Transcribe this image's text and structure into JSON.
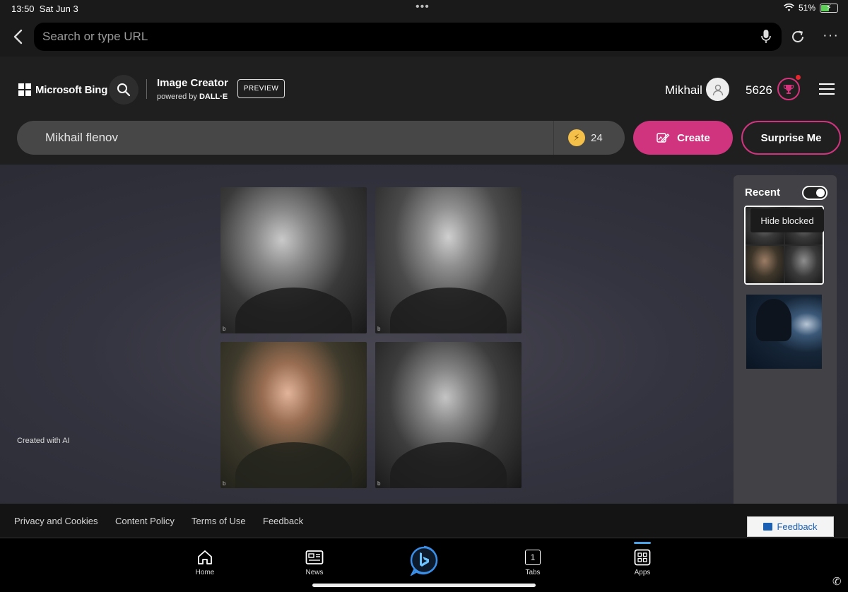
{
  "status_bar": {
    "time": "13:50",
    "date": "Sat Jun 3",
    "battery": "51%",
    "battery_level": 0.51
  },
  "browser": {
    "url_placeholder": "Search or type URL"
  },
  "header": {
    "brand": "Microsoft Bing",
    "product_title": "Image Creator",
    "powered_by": "powered by",
    "powered_by_brand": "DALL·E",
    "badge": "PREVIEW",
    "user_name": "Mikhail",
    "points": "5626"
  },
  "prompt": {
    "value": "Mikhail flenov",
    "boosts": "24"
  },
  "actions": {
    "create_label": "Create",
    "surprise_label": "Surprise Me"
  },
  "main": {
    "created_with_ai": "Created with AI"
  },
  "recent": {
    "title": "Recent",
    "toggle_tooltip": "Hide blocked",
    "hide_blocked_on": true
  },
  "footer": {
    "links": [
      "Privacy and Cookies",
      "Content Policy",
      "Terms of Use",
      "Feedback"
    ],
    "feedback_button": "Feedback"
  },
  "bottom_nav": {
    "home": "Home",
    "news": "News",
    "tabs": "Tabs",
    "tabs_count": "1",
    "apps": "Apps"
  },
  "colors": {
    "accent": "#d1347f",
    "link_blue": "#1a5fb4"
  }
}
